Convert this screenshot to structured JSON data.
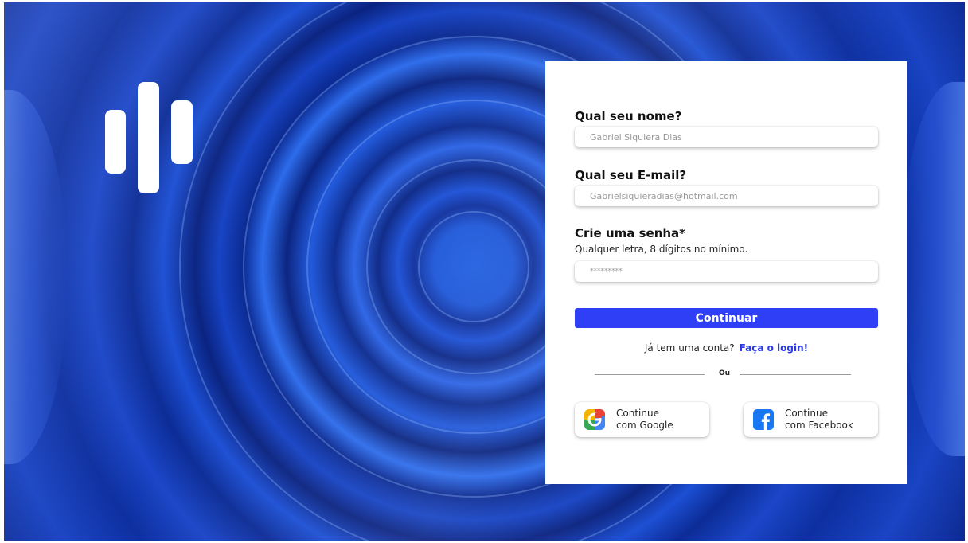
{
  "form": {
    "name_label": "Qual seu nome?",
    "name_placeholder": "Gabriel Siquiera Dias",
    "email_label": "Qual seu E-mail?",
    "email_placeholder": "Gabrielsiquieradias@hotmail.com",
    "password_label": "Crie uma senha*",
    "password_hint": "Qualquer letra, 8 dígitos no mínimo.",
    "password_placeholder": "*********",
    "continue_label": "Continuar"
  },
  "login": {
    "prompt": "Já tem uma conta?",
    "link": "Faça o login!"
  },
  "divider": {
    "text": "Ou"
  },
  "social": {
    "google": {
      "line1": "Continue",
      "line2": "com Google",
      "icon": "google-icon"
    },
    "facebook": {
      "line1": "Continue",
      "line2": "com Facebook",
      "icon": "facebook-icon"
    }
  },
  "colors": {
    "primary": "#2f3ff5",
    "link": "#2a3ae8",
    "background": "#1a4fd6"
  }
}
